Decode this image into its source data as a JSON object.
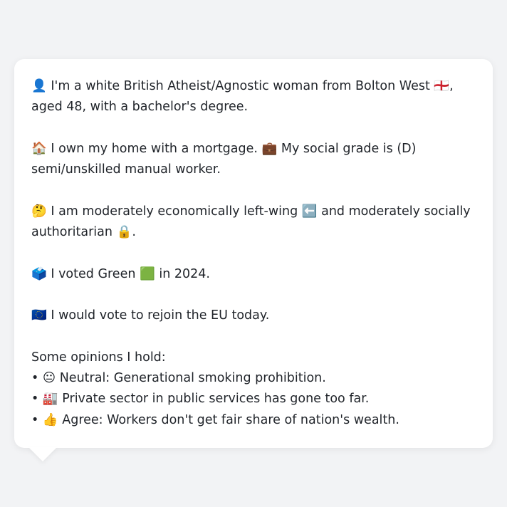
{
  "profile": {
    "identity": "👤 I'm a white British Atheist/Agnostic woman from Bolton West 🏴󠁧󠁢󠁥󠁮󠁧󠁿, aged 48, with a bachelor's degree.",
    "housing": "🏠 I own my home with a mortgage. 💼 My social grade is (D) semi/unskilled manual worker.",
    "politics": "🤔 I am moderately economically left-wing ⬅️ and moderately socially authoritarian 🔒.",
    "vote": "🗳️ I voted Green 🟩 in 2024.",
    "eu": "🇪🇺 I would vote to rejoin the EU today."
  },
  "opinions": {
    "heading": "Some opinions I hold:",
    "bullet": "•",
    "items": [
      "😐 Neutral: Generational smoking prohibition.",
      "🏭 Private sector in public services has gone too far.",
      "👍 Agree: Workers don't get fair share of nation's wealth."
    ]
  }
}
